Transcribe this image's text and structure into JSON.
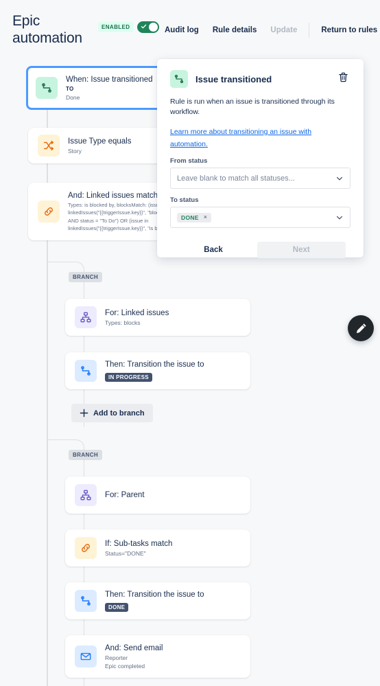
{
  "header": {
    "rule_title": "Epic automation",
    "enabled_label": "ENABLED",
    "toggle_state": "on",
    "nav": [
      {
        "label": "Audit log",
        "disabled": false
      },
      {
        "label": "Rule details",
        "disabled": false
      },
      {
        "label": "Update",
        "disabled": true
      },
      {
        "label": "Return to rules",
        "disabled": false
      }
    ]
  },
  "tree": {
    "trigger": {
      "title": "When: Issue transitioned",
      "sub_caps": "TO",
      "sub": "Done",
      "icon": "transition-icon",
      "selected": true
    },
    "condition_issue_type": {
      "title": "Issue Type equals",
      "sub": "Story",
      "icon": "shuffle-icon"
    },
    "condition_linked": {
      "title": "And: Linked issues match",
      "sub": "Types: is blocked by, blocksMatch: (issue in linkedIssues(\"{{triggerIssue.key}}\", \"blocks\") AND status = \"To Do\") OR (issue in linkedIssues(\"{{triggerIssue.key}}\", \"is blocked by\") AND status = \"Done\")",
      "icon": "link-icon"
    },
    "branch1_chip": "BRANCH",
    "branch1_for": {
      "title": "For: Linked issues",
      "sub": "Types: blocks",
      "icon": "branch-tree-icon"
    },
    "branch1_then": {
      "title": "Then: Transition the issue to",
      "lozenge": "IN PROGRESS",
      "icon": "transition-icon"
    },
    "add_to_branch_label": "Add to branch",
    "branch2_chip": "BRANCH",
    "branch2_for": {
      "title": "For: Parent",
      "icon": "branch-tree-icon"
    },
    "branch2_if": {
      "title": "If: Sub-tasks match",
      "sub": "Status=\"DONE\"",
      "icon": "link-icon"
    },
    "branch2_then": {
      "title": "Then: Transition the issue to",
      "lozenge": "DONE",
      "icon": "transition-icon"
    },
    "branch2_email": {
      "title": "And: Send email",
      "sub1": "Reporter",
      "sub2": "Epic completed",
      "icon": "envelope-icon"
    }
  },
  "fab": {
    "icon": "pencil-icon"
  },
  "panel": {
    "title": "Issue transitioned",
    "icon": "transition-icon",
    "delete_icon": "trash-icon",
    "description": "Rule is run when an issue is transitioned through its workflow.",
    "link_text": "Learn more about transitioning an issue with automation.",
    "from_status_label": "From status",
    "from_status_placeholder": "Leave blank to match all statuses...",
    "from_status_value": "",
    "to_status_label": "To status",
    "to_status_chip": "DONE",
    "to_status_chip_remove": "×",
    "back_label": "Back",
    "next_label": "Next"
  },
  "colors": {
    "background": "#F7F8F9",
    "accent_blue": "#4C9AFF",
    "link_blue": "#0C66E4",
    "toggle_green": "#1F845A",
    "lozenge_dark": "#42526E",
    "text_primary": "#172B4D",
    "text_subtle": "#626F86"
  }
}
